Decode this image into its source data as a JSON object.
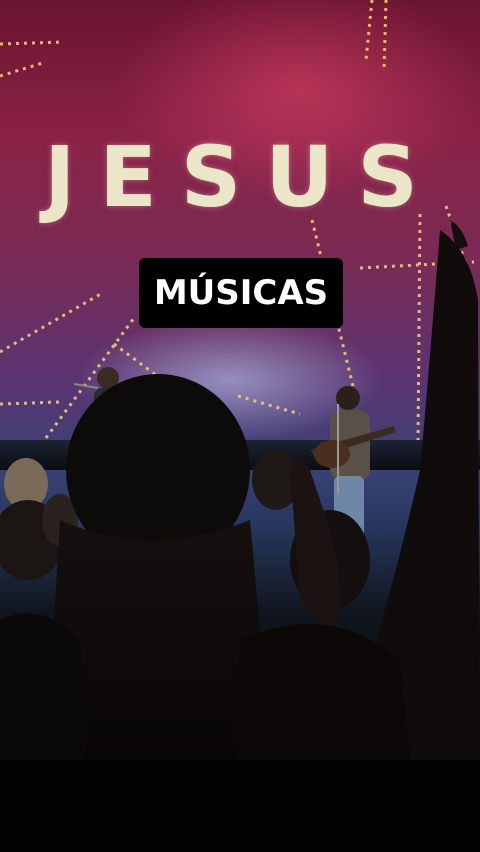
{
  "screen": {
    "word": "JESUS"
  },
  "overlay": {
    "caption": "MÚSICAS"
  },
  "colors": {
    "screen_text": "#ece6c9",
    "caption_bg": "#000000",
    "caption_text": "#ffffff",
    "streak": "#f3c873"
  }
}
